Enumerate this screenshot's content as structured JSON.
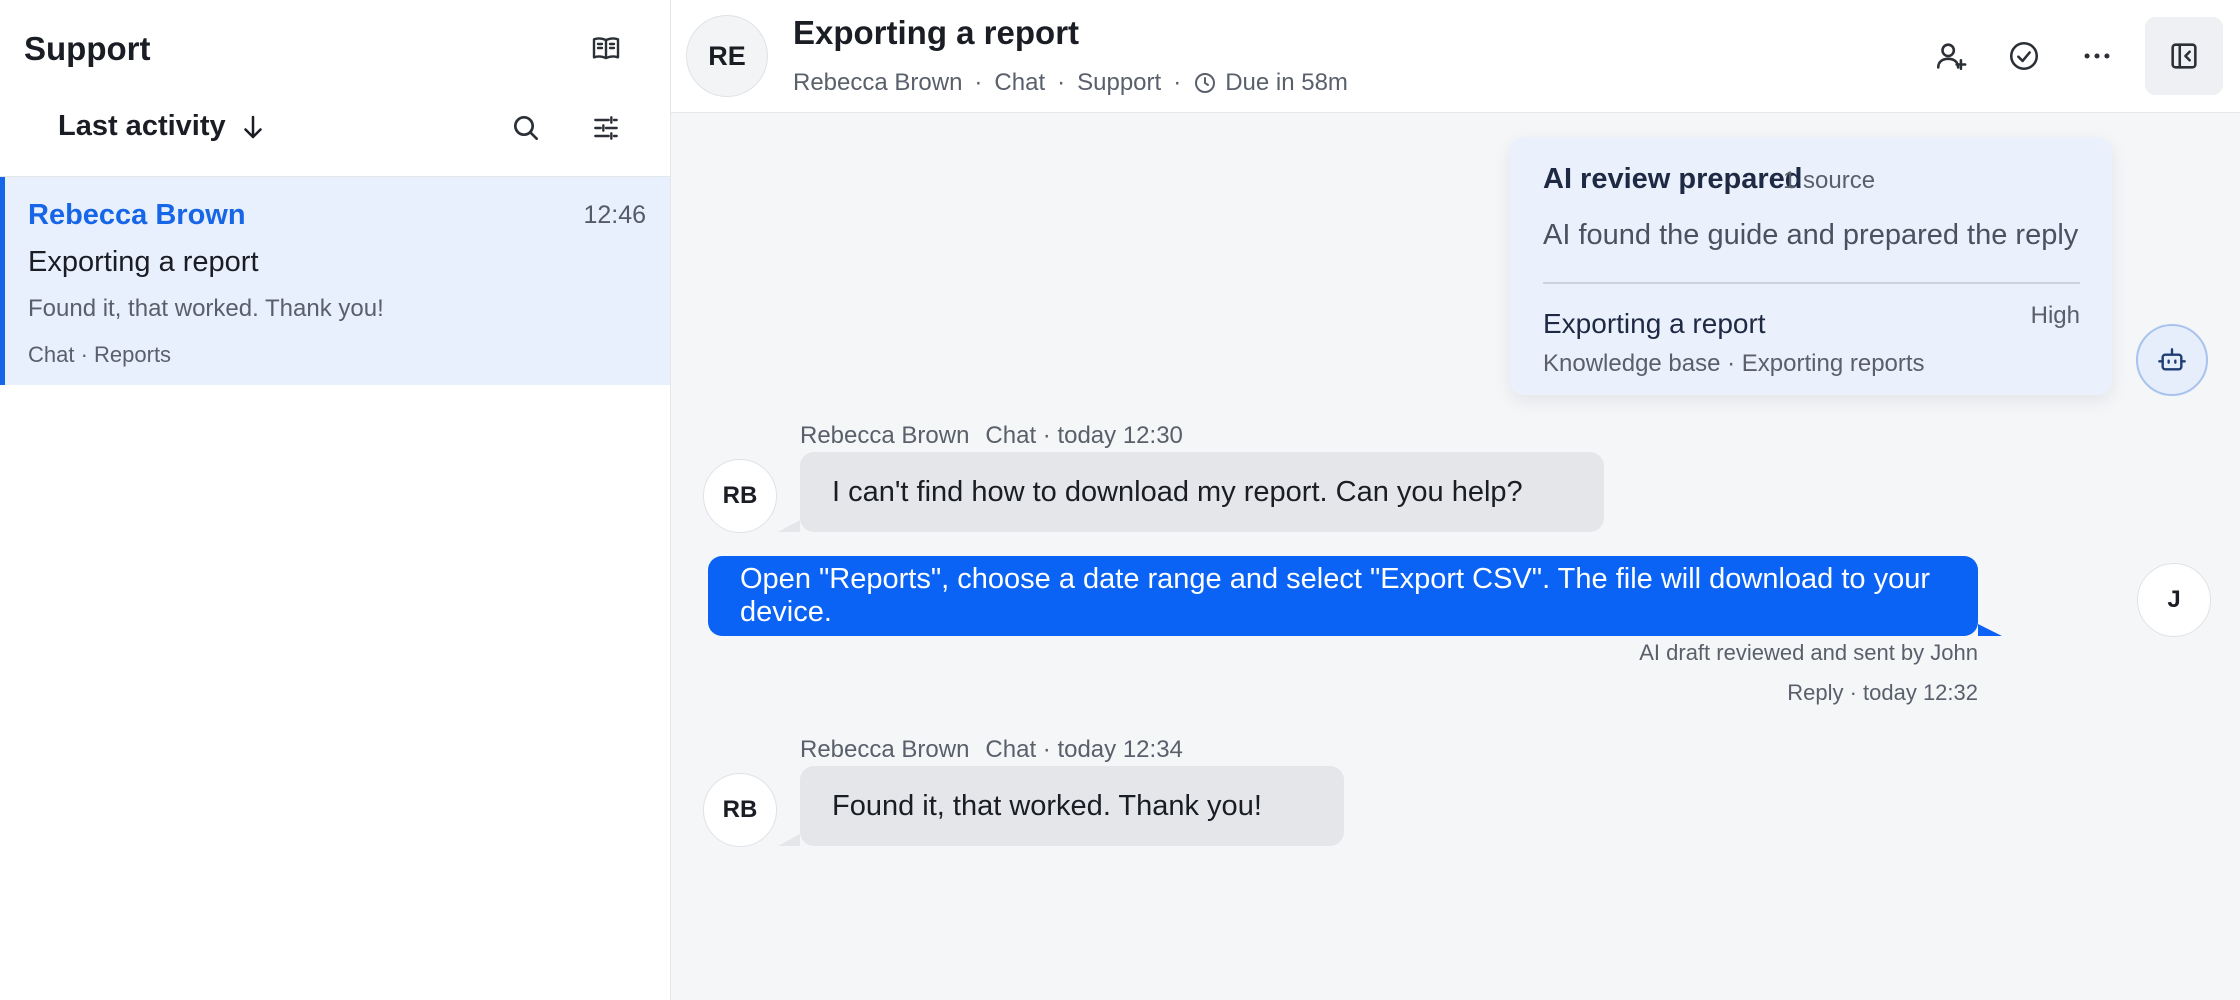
{
  "sidebar": {
    "title": "Support",
    "knowledge_icon": "book-open-icon",
    "sort_label": "Last activity",
    "sort_icon": "arrow-down-icon",
    "search_icon": "search-icon",
    "filter_icon": "sliders-icon",
    "conversations": [
      {
        "name": "Rebecca Brown",
        "time": "12:46",
        "subject": "Exporting a report",
        "preview": "Found it, that worked. Thank you!",
        "meta": "Chat · Reports"
      }
    ]
  },
  "header": {
    "avatar_initials": "RE",
    "title": "Exporting a report",
    "customer": "Rebecca Brown",
    "channel": "Chat",
    "team": "Support",
    "separator": "·",
    "due": "Due in 58m",
    "clock_icon": "clock-icon",
    "assign_icon": "user-plus-icon",
    "resolve_icon": "check-circle-icon",
    "more_icon": "more-horizontal-icon",
    "panel_icon": "panel-toggle-icon"
  },
  "ai_review": {
    "title": "AI review prepared",
    "source_count": "1 source",
    "description": "AI found the guide and prepared the reply",
    "source": {
      "title": "Exporting a report",
      "level": "High",
      "path": "Knowledge base · Exporting reports"
    },
    "bot_icon": "bot-icon"
  },
  "messages": [
    {
      "author": "Rebecca Brown",
      "meta": "Chat · today 12:30",
      "initials": "RB",
      "text": "I can't find how to download my report. Can you help?"
    },
    {
      "initials": "J",
      "text": "Open \"Reports\", choose a date range and select \"Export CSV\". The file will download to your device.",
      "note": "AI draft reviewed and sent by John",
      "meta": "Reply · today 12:32"
    },
    {
      "author": "Rebecca Brown",
      "meta": "Chat · today 12:34",
      "initials": "RB",
      "text": "Found it, that worked. Thank you!"
    }
  ],
  "colors": {
    "accent": "#1766e8",
    "outgoing_bubble": "#0a63f5",
    "incoming_bubble": "#e4e6e9",
    "ai_panel": "#ebf1fc"
  }
}
